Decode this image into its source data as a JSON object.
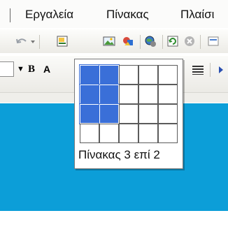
{
  "menubar": {
    "items": [
      {
        "label": "Εργαλεία",
        "underline_char": "λ"
      },
      {
        "label": "Πίνακας",
        "underline_char": "ν"
      },
      {
        "label": "Πλαίσι",
        "underline_char": "ι"
      }
    ]
  },
  "toolbar": {
    "icons": [
      "undo-arrow-icon",
      "dropdown-arrow-icon",
      "insert-hyperlink-icon",
      "insert-table-icon",
      "insert-picture-icon",
      "drawing-icon",
      "web-globe-icon",
      "refresh-icon",
      "stop-icon"
    ]
  },
  "formatting": {
    "font_value_tail": "",
    "bold_label": "B",
    "italic_tail": "A"
  },
  "table_grid": {
    "columns": 5,
    "rows": 4,
    "selected_columns": 2,
    "selected_rows": 3,
    "caption": "Πίνακας 3 επί 2",
    "selection_color": "#3a6fd8"
  },
  "colors": {
    "document_background": "#0c9ed8",
    "active_button": "#ffe6a0"
  }
}
